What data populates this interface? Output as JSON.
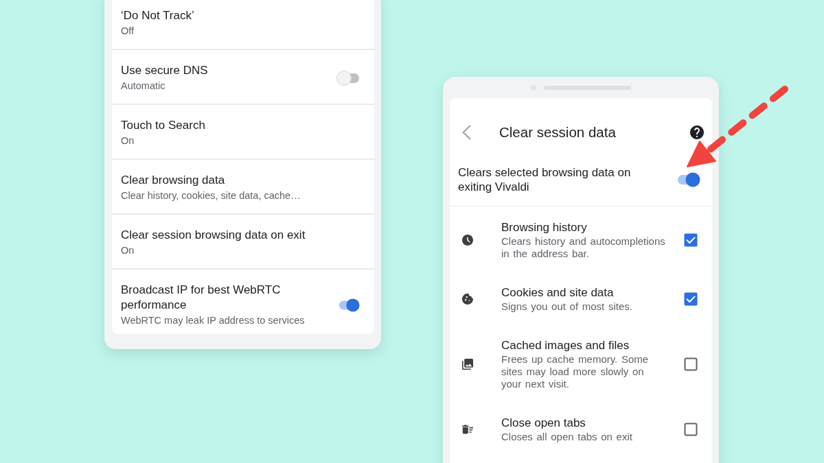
{
  "left_screen": {
    "settings": [
      {
        "kind": "text",
        "title": "‘Do Not Track’",
        "subtitle": "Off"
      },
      {
        "kind": "switch",
        "title": "Use secure DNS",
        "subtitle": "Automatic",
        "on": false
      },
      {
        "kind": "text",
        "title": "Touch to Search",
        "subtitle": "On"
      },
      {
        "kind": "text",
        "title": "Clear browsing data",
        "subtitle": "Clear history, cookies, site data, cache…"
      },
      {
        "kind": "text",
        "title": "Clear session browsing data on exit",
        "subtitle": "On"
      },
      {
        "kind": "switch",
        "title": "Broadcast IP for best WebRTC performance",
        "subtitle": "WebRTC may leak IP address to services",
        "on": true
      }
    ]
  },
  "right_screen": {
    "title": "Clear session data",
    "master_switch": {
      "label": "Clears selected browsing data on exiting Vivaldi",
      "on": true
    },
    "options": [
      {
        "title": "Browsing history",
        "description": "Clears history and autocompletions in the address bar.",
        "checked": true
      },
      {
        "title": "Cookies and site data",
        "description": "Signs you out of most sites.",
        "checked": true
      },
      {
        "title": "Cached images and files",
        "description": "Frees up cache memory. Some sites may load more slowly on your next visit.",
        "checked": false
      },
      {
        "title": "Close open tabs",
        "description": "Closes all open tabs on exit",
        "checked": false
      }
    ]
  }
}
